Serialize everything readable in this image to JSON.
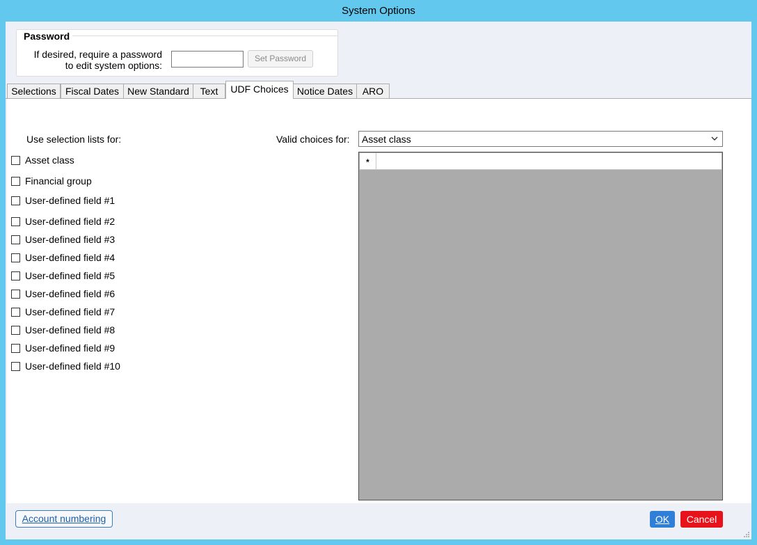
{
  "window": {
    "title": "System Options"
  },
  "password": {
    "legend": "Password",
    "prompt_line1": "If desired, require a password",
    "prompt_line2": "to edit system options:",
    "value": "",
    "button_label": "Set Password"
  },
  "tabs": [
    {
      "label": "Selections",
      "active": false
    },
    {
      "label": "Fiscal Dates",
      "active": false
    },
    {
      "label": "New Standard",
      "active": false
    },
    {
      "label": "Text",
      "active": false
    },
    {
      "label": "UDF Choices",
      "active": true
    },
    {
      "label": "Notice Dates",
      "active": false
    },
    {
      "label": "ARO",
      "active": false
    }
  ],
  "udf": {
    "selection_lists_label": "Use selection lists for:",
    "valid_choices_label": "Valid choices for:",
    "valid_choices_selected": "Asset class",
    "checkboxes": [
      {
        "label": "Asset class",
        "checked": false
      },
      {
        "label": "Financial group",
        "checked": false
      },
      {
        "label": "User-defined field #1",
        "checked": false
      },
      {
        "label": "User-defined field #2",
        "checked": false
      },
      {
        "label": "User-defined field #3",
        "checked": false
      },
      {
        "label": "User-defined field #4",
        "checked": false
      },
      {
        "label": "User-defined field #5",
        "checked": false
      },
      {
        "label": "User-defined field #6",
        "checked": false
      },
      {
        "label": "User-defined field #7",
        "checked": false
      },
      {
        "label": "User-defined field #8",
        "checked": false
      },
      {
        "label": "User-defined field #9",
        "checked": false
      },
      {
        "label": "User-defined field #10",
        "checked": false
      }
    ],
    "grid_new_row_marker": "*",
    "grid_new_row_value": ""
  },
  "footer": {
    "account_numbering_label": "Account numbering",
    "ok_label": "OK",
    "cancel_label": "Cancel"
  },
  "colors": {
    "titlebar": "#62c8ee",
    "ok": "#2f7fd8",
    "cancel": "#e8121b",
    "grid_background": "#ababab"
  }
}
